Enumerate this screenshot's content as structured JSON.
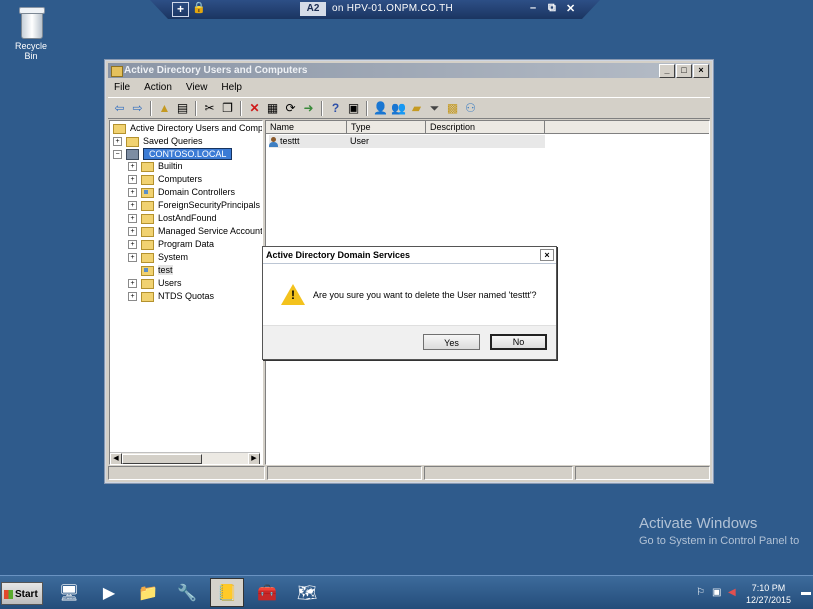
{
  "remote_bar": {
    "pin": "+",
    "lock": "🔒",
    "session_badge": "A2",
    "host": "on HPV-01.ONPM.CO.TH",
    "minimize": "–",
    "restore": "⧉",
    "close": "✕"
  },
  "desktop": {
    "recycle_bin_label": "Recycle Bin"
  },
  "window": {
    "title": "Active Directory Users and Computers",
    "btn_min": "_",
    "btn_max": "□",
    "btn_close": "×",
    "menu": [
      "File",
      "Action",
      "View",
      "Help"
    ],
    "toolbar_icons": [
      "back-icon",
      "forward-icon",
      "up-icon",
      "show-hide-tree-icon",
      "cut-icon",
      "copy-icon",
      "delete-icon",
      "properties-icon",
      "refresh-icon",
      "export-icon",
      "help-icon",
      "console-icon",
      "new-user-icon",
      "new-group-icon",
      "new-ou-icon",
      "filter-icon",
      "add-to-group-icon",
      "delegate-icon"
    ]
  },
  "tree": {
    "root": "Active Directory Users and Comput",
    "saved_queries": "Saved Queries",
    "domain": "CONTOSO.LOCAL",
    "children": [
      "Builtin",
      "Computers",
      "Domain Controllers",
      "ForeignSecurityPrincipals",
      "LostAndFound",
      "Managed Service Accounts",
      "Program Data",
      "System",
      "test",
      "Users",
      "NTDS Quotas"
    ]
  },
  "list": {
    "columns": [
      "Name",
      "Type",
      "Description"
    ],
    "rows": [
      {
        "name": "testtt",
        "type": "User",
        "description": ""
      }
    ]
  },
  "dialog": {
    "title": "Active Directory Domain Services",
    "close": "×",
    "message": "Are you sure you want to delete the User named 'testtt'?",
    "yes_label": "Yes",
    "no_label": "No"
  },
  "watermark": {
    "line1": "Activate Windows",
    "line2": "Go to System in Control Panel to"
  },
  "taskbar": {
    "start_label": "Start",
    "clock_time": "7:10 PM",
    "clock_date": "12/27/2015"
  }
}
